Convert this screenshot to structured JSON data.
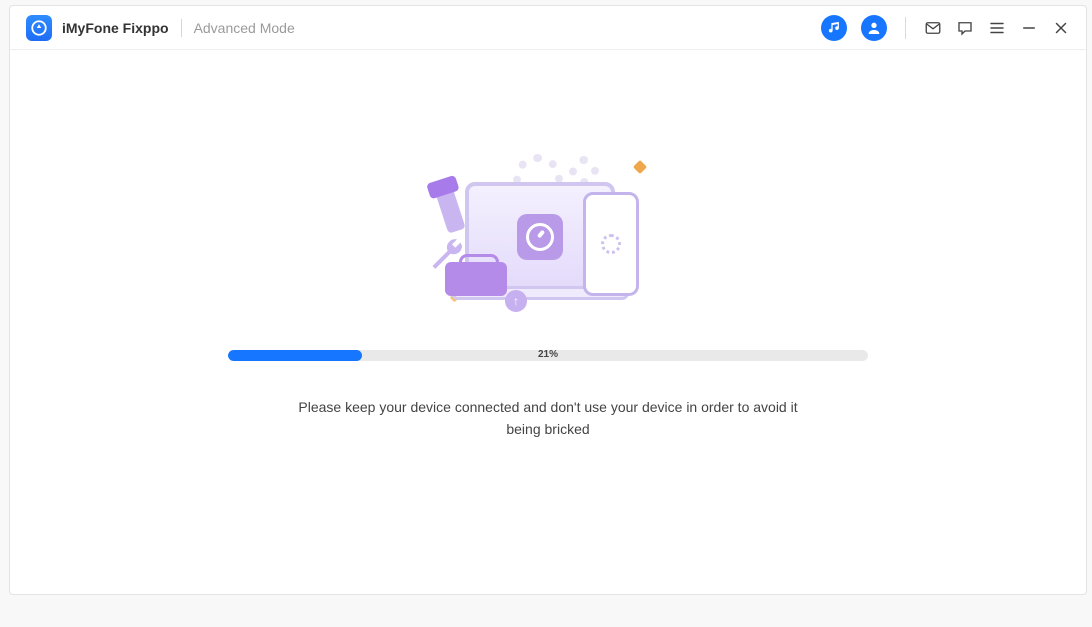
{
  "header": {
    "app_title": "iMyFone Fixppo",
    "mode_label": "Advanced Mode",
    "icons": {
      "music": "music-icon",
      "user": "user-icon",
      "mail": "mail-icon",
      "chat": "chat-icon",
      "menu": "menu-icon",
      "minimize": "minimize-icon",
      "close": "close-icon"
    }
  },
  "progress": {
    "percent_value": 21,
    "percent_label": "21%",
    "bar_width": "21%"
  },
  "message": "Please keep your device connected and don't use your device in order to avoid it being bricked",
  "colors": {
    "accent": "#1676ff",
    "purple": "#b48be8"
  }
}
